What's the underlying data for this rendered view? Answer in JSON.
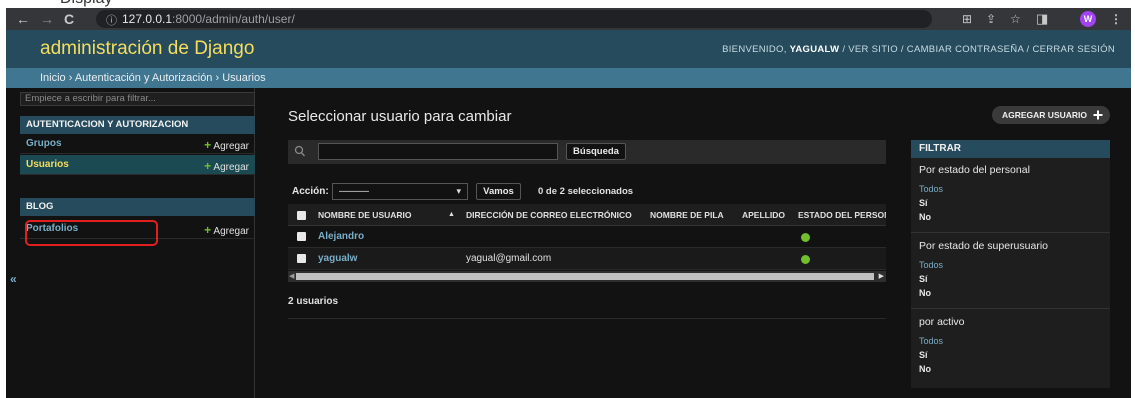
{
  "top_text": "Display",
  "browser": {
    "url_host": "127.0.0.1",
    "url_rest": ":8000/admin/auth/user/",
    "avatar_letter": "W"
  },
  "header": {
    "branding": "administración de Django",
    "welcome": "BIENVENIDO,",
    "username": "YAGUALW",
    "view_site": "VER SITIO",
    "change_password": "CAMBIAR CONTRASEÑA",
    "logout": "CERRAR SESIÓN",
    "separator": "/"
  },
  "breadcrumbs": "Inicio › Autenticación y Autorización › Usuarios",
  "sidebar": {
    "filter_placeholder": "Empiece a escribir para filtrar...",
    "apps": [
      {
        "caption": "AUTENTICACION Y AUTORIZACION",
        "models": [
          {
            "name": "Grupos",
            "add": "Agregar"
          },
          {
            "name": "Usuarios",
            "add": "Agregar"
          }
        ]
      },
      {
        "caption": "BLOG",
        "models": [
          {
            "name": "Portafolios",
            "add": "Agregar"
          }
        ]
      }
    ],
    "collapse_label": "«"
  },
  "main": {
    "title": "Seleccionar usuario para cambiar",
    "add_button": "AGREGAR USUARIO",
    "search_button": "Búsqueda",
    "action_label": "Acción:",
    "action_selected": "———",
    "go_button": "Vamos",
    "action_counter": "0 de 2 seleccionados",
    "columns": [
      "NOMBRE DE USUARIO",
      "DIRECCIÓN DE CORREO ELECTRÓNICO",
      "NOMBRE DE PILA",
      "APELLIDO",
      "ESTADO DEL PERSONA"
    ],
    "rows": [
      {
        "username": "Alejandro",
        "email": "",
        "first_name": "",
        "last_name": ""
      },
      {
        "username": "yagualw",
        "email": "yagual@gmail.com",
        "first_name": "",
        "last_name": ""
      }
    ],
    "paginator": "2 usuarios"
  },
  "filter": {
    "heading": "FILTRAR",
    "groups": [
      {
        "title": "Por estado del personal",
        "options": [
          "Todos",
          "Sí",
          "No"
        ]
      },
      {
        "title": "Por estado de superusuario",
        "options": [
          "Todos",
          "Sí",
          "No"
        ]
      },
      {
        "title": "por activo",
        "options": [
          "Todos",
          "Sí",
          "No"
        ]
      }
    ]
  },
  "colors": {
    "header_bg": "#264b5d",
    "breadcrumb_bg": "#417690",
    "branding": "#f5dd5d",
    "link": "#79aec8",
    "add_green": "#70bf2b",
    "highlight_red": "#e02020"
  }
}
